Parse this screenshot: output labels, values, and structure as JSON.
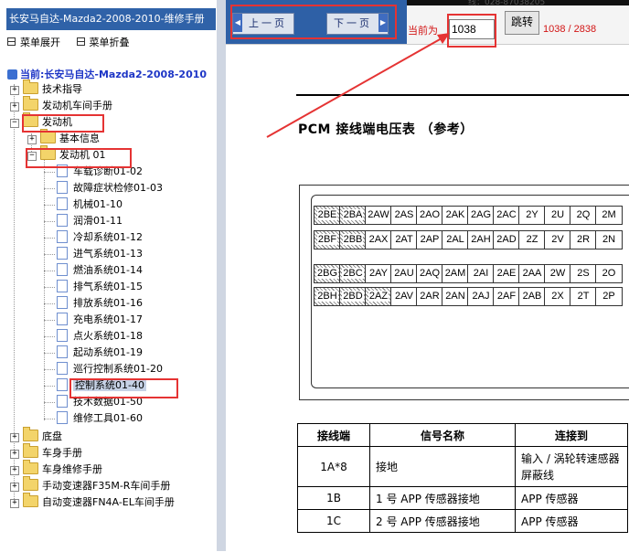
{
  "left_panel": {
    "title": "长安马自达-Mazda2-2008-2010-维修手册",
    "menu": {
      "expand": "菜单展开",
      "collapse": "菜单折叠"
    },
    "current": "当前:长安马自达-Mazda2-2008-2010",
    "tree": {
      "top": [
        "技术指导",
        "发动机车间手册"
      ],
      "engine": "发动机",
      "basic_info": "基本信息",
      "engine01": "发动机 01",
      "sections": [
        "车载诊断01-02",
        "故障症状检修01-03",
        "机械01-10",
        "润滑01-11",
        "冷却系统01-12",
        "进气系统01-13",
        "燃油系统01-14",
        "排气系统01-15",
        "排放系统01-16",
        "充电系统01-17",
        "点火系统01-18",
        "起动系统01-19",
        "巡行控制系统01-20",
        "控制系统01-40",
        "技术数据01-50",
        "维修工具01-60"
      ],
      "bottom": [
        "底盘",
        "车身手册",
        "车身维修手册",
        "手动变速器F35M-R车间手册",
        "自动变速器FN4A-EL车间手册"
      ]
    }
  },
  "toolbar": {
    "prev": "上一页",
    "next": "下一页",
    "current_label": "当前为",
    "page_value": "1038",
    "jump": "跳转",
    "page_count": "1038 / 2838",
    "top_strip_text": "线：028-87038205"
  },
  "document": {
    "title": "PCM 接线端电压表 （参考）",
    "connector_rows": [
      [
        "2BE",
        "2BA",
        "2AW",
        "2AS",
        "2AO",
        "2AK",
        "2AG",
        "2AC",
        "2Y",
        "2U",
        "2Q",
        "2M"
      ],
      [
        "2BF",
        "2BB",
        "2AX",
        "2AT",
        "2AP",
        "2AL",
        "2AH",
        "2AD",
        "2Z",
        "2V",
        "2R",
        "2N"
      ],
      [
        "2BG",
        "2BC",
        "2AY",
        "2AU",
        "2AQ",
        "2AM",
        "2AI",
        "2AE",
        "2AA",
        "2W",
        "2S",
        "2O"
      ],
      [
        "2BH",
        "2BD",
        "2AZ",
        "2AV",
        "2AR",
        "2AN",
        "2AJ",
        "2AF",
        "2AB",
        "2X",
        "2T",
        "2P"
      ]
    ],
    "table_headers": [
      "接线端",
      "信号名称",
      "连接到"
    ],
    "table_rows": [
      [
        "1A*8",
        "接地",
        "输入 / 涡轮转速感器屏蔽线"
      ],
      [
        "1B",
        "1 号 APP 传感器接地",
        "APP 传感器"
      ],
      [
        "1C",
        "2 号 APP 传感器接地",
        "APP 传感器"
      ]
    ]
  },
  "colors": {
    "accent": "#2e60a6",
    "annotation_red": "#e53333",
    "page_red": "#d21414"
  }
}
